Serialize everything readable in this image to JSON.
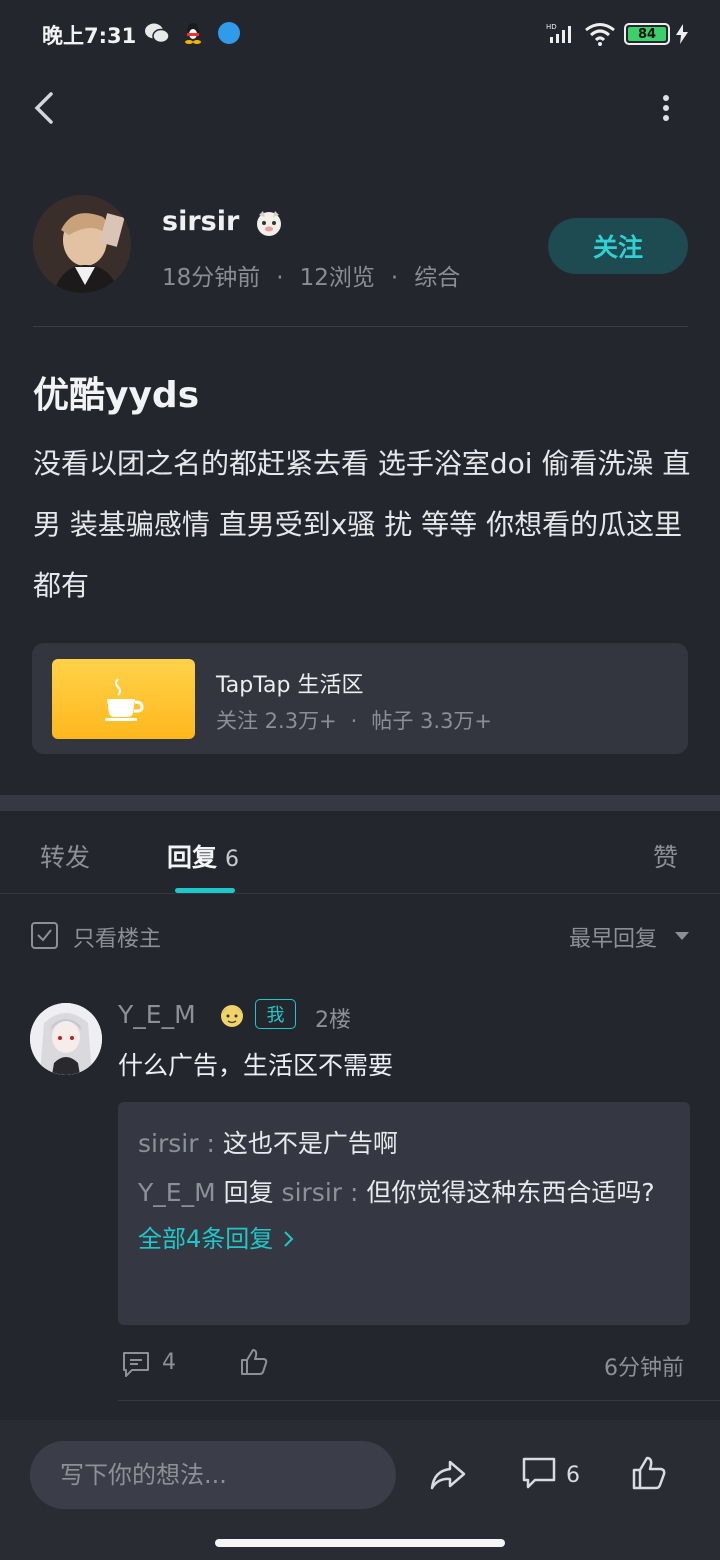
{
  "status_bar": {
    "time": "晚上7:31",
    "battery": "84"
  },
  "post": {
    "author": "sirsir",
    "time_ago": "18分钟前",
    "views": "12浏览",
    "category": "综合",
    "follow_label": "关注",
    "title": "优酷yyds",
    "body": "没看以团之名的都赶紧去看 选手浴室doi 偷看洗澡 直男 装基骗感情 直男受到x骚 扰 等等 你想看的瓜这里都有"
  },
  "group": {
    "name": "TapTap 生活区",
    "followers": "关注 2.3万+",
    "posts": "帖子 3.3万+"
  },
  "tabs": {
    "forward": "转发",
    "reply": "回复",
    "reply_count": "6",
    "like": "赞"
  },
  "filter": {
    "only_op": "只看楼主",
    "sort": "最早回复"
  },
  "comment": {
    "user": "Y_E_M",
    "me_badge": "我",
    "floor": "2楼",
    "text": "什么广告，生活区不需要",
    "replies": [
      {
        "user": "sirsir",
        "sep": " : ",
        "text": "这也不是广告啊"
      },
      {
        "user": "Y_E_M",
        "mid": " 回复 ",
        "target": "sirsir",
        "sep": " : ",
        "text": "但你觉得这种东西合适吗?"
      }
    ],
    "more_replies": "全部4条回复",
    "reply_count": "4",
    "time": "6分钟前"
  },
  "bottom_bar": {
    "input_placeholder": "写下你的想法...",
    "comment_count": "6"
  },
  "colors": {
    "background": "#24262e",
    "accent": "#1fc8c8",
    "follow_bg": "#1e4a51",
    "card_bg": "#33363f",
    "group_icon": "#ffc22e"
  }
}
